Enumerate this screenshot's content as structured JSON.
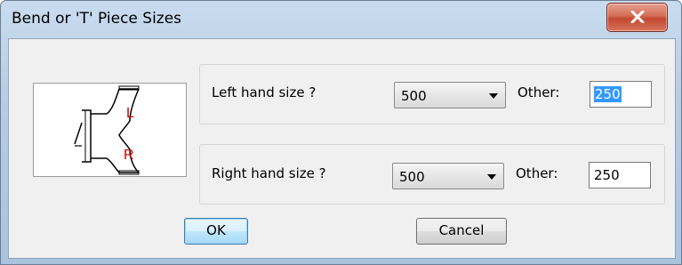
{
  "window": {
    "title": "Bend or 'T' Piece Sizes",
    "close_label": "X"
  },
  "preview": {
    "left_marker": "L",
    "right_marker": "R",
    "marker_color": "#cc0000"
  },
  "left": {
    "label": "Left hand size  ?",
    "selected_size": "500",
    "other_label": "Other:",
    "other_value": "250"
  },
  "right": {
    "label": "Right hand size ?",
    "selected_size": "500",
    "other_label": "Other:",
    "other_value": "250"
  },
  "buttons": {
    "ok": "OK",
    "cancel": "Cancel"
  }
}
